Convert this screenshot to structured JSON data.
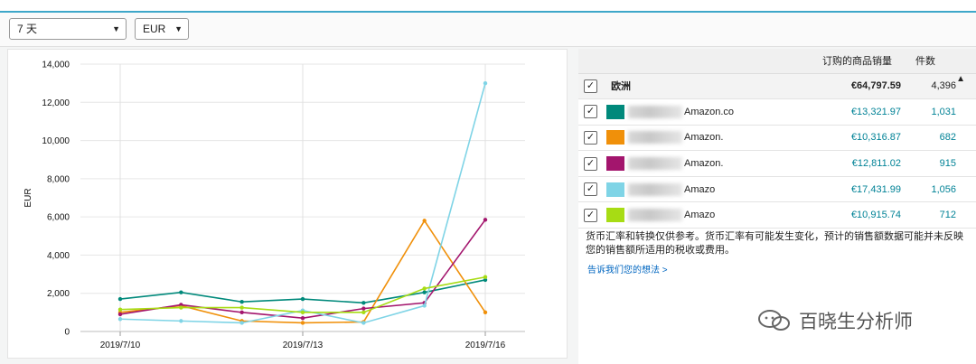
{
  "controls": {
    "period": "7 天",
    "currency": "EUR"
  },
  "table": {
    "header_sales": "订购的商品销量",
    "header_units": "件数",
    "region": {
      "name": "欧洲",
      "sales": "€64,797.59",
      "units": "4,396"
    },
    "rows": [
      {
        "label": "Amazon.co",
        "color": "#00897b",
        "sales": "€13,321.97",
        "units": "1,031"
      },
      {
        "label": "Amazon.",
        "color": "#f0900a",
        "sales": "€10,316.87",
        "units": "682"
      },
      {
        "label": "Amazon.",
        "color": "#a3156d",
        "sales": "€12,811.02",
        "units": "915"
      },
      {
        "label": "Amazo",
        "color": "#7fd4e6",
        "sales": "€17,431.99",
        "units": "1,056"
      },
      {
        "label": "Amazo",
        "color": "#a7dc14",
        "sales": "€10,915.74",
        "units": "712"
      }
    ]
  },
  "note": "货币汇率和转换仅供参考。货币汇率有可能发生变化，预计的销售额数据可能并未反映您的销售额所适用的税收或费用。",
  "feedback_link": "告诉我们您的想法 >",
  "watermark": "百晓生分析师",
  "colors": {
    "teal": "#008296",
    "link": "#0066c0"
  },
  "chart_data": {
    "type": "line",
    "x": [
      "2019/7/10",
      "2019/7/11",
      "2019/7/12",
      "2019/7/13",
      "2019/7/14",
      "2019/7/15",
      "2019/7/16"
    ],
    "x_ticks": [
      "2019/7/10",
      "2019/7/13",
      "2019/7/16"
    ],
    "ylabel": "EUR",
    "ylim": [
      0,
      14000
    ],
    "yticks": [
      0,
      2000,
      4000,
      6000,
      8000,
      10000,
      12000,
      14000
    ],
    "ytick_labels": [
      "0",
      "2,000",
      "4,000",
      "6,000",
      "8,000",
      "10,000",
      "12,000",
      "14,000"
    ],
    "grid": true,
    "series": [
      {
        "color": "#00897b",
        "values": [
          1700,
          2050,
          1550,
          1700,
          1500,
          2050,
          2700
        ]
      },
      {
        "color": "#f0900a",
        "values": [
          1000,
          1350,
          550,
          450,
          500,
          5800,
          1000
        ]
      },
      {
        "color": "#a3156d",
        "values": [
          900,
          1400,
          1000,
          700,
          1200,
          1500,
          5850
        ]
      },
      {
        "color": "#7fd4e6",
        "values": [
          650,
          550,
          450,
          1100,
          450,
          1350,
          13000
        ]
      },
      {
        "color": "#a7dc14",
        "values": [
          1150,
          1250,
          1250,
          1000,
          1000,
          2250,
          2850
        ]
      }
    ]
  }
}
